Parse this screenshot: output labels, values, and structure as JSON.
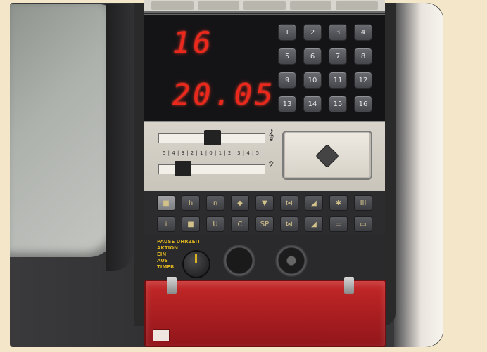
{
  "display": {
    "channel": "16",
    "time": "20.05"
  },
  "keypad": {
    "keys": [
      "1",
      "2",
      "3",
      "4",
      "5",
      "6",
      "7",
      "8",
      "9",
      "10",
      "11",
      "12",
      "13",
      "14",
      "15",
      "16"
    ]
  },
  "tone_controls": {
    "scale": "5 | 4 | 3 | 2 | 1 | 0 | 1 | 2 | 3 | 4 | 5",
    "treble_symbol": "𝄞",
    "bass_symbol": "𝄢"
  },
  "function_keys": {
    "row1": [
      "■",
      "h",
      "n",
      "◆",
      "▼",
      "⋈",
      "◢",
      "✱",
      "III"
    ],
    "row2": [
      "i",
      "■",
      "U",
      "C",
      "SP",
      "⋈",
      "◢",
      "▭",
      "▭"
    ]
  },
  "timer": {
    "label_line1": "PAUSE",
    "label_uhrzeit": "UHRZEIT",
    "label_aktion": "AKTION",
    "label_ein": "EIN",
    "label_aus": "AUS",
    "label_timer": "TIMER"
  },
  "colors": {
    "led": "#ff2a1e",
    "flap": "#c8262a",
    "timer_label": "#d8b020"
  }
}
